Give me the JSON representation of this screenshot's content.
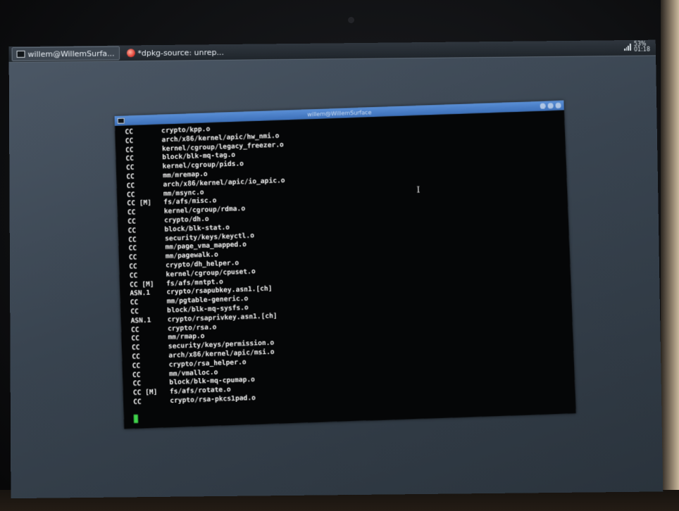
{
  "taskbar": {
    "tasks": [
      {
        "label": "willem@WillemSurfa...",
        "icon": "terminal-icon",
        "active": true
      },
      {
        "label": "*dpkg-source: unrep...",
        "icon": "package-warning-icon",
        "active": false
      }
    ],
    "tray": {
      "battery": "53%",
      "clock": "01:18"
    }
  },
  "terminal": {
    "title": "willem@WillemSurface",
    "lines": [
      {
        "tag": "CC",
        "path": "crypto/kpp.o"
      },
      {
        "tag": "CC",
        "path": "arch/x86/kernel/apic/hw_nmi.o"
      },
      {
        "tag": "CC",
        "path": "kernel/cgroup/legacy_freezer.o"
      },
      {
        "tag": "CC",
        "path": "block/blk-mq-tag.o"
      },
      {
        "tag": "CC",
        "path": "kernel/cgroup/pids.o"
      },
      {
        "tag": "CC",
        "path": "mm/mremap.o"
      },
      {
        "tag": "CC",
        "path": "arch/x86/kernel/apic/io_apic.o"
      },
      {
        "tag": "CC",
        "path": "mm/msync.o"
      },
      {
        "tag": "CC [M]",
        "path": "fs/afs/misc.o"
      },
      {
        "tag": "CC",
        "path": "kernel/cgroup/rdma.o"
      },
      {
        "tag": "CC",
        "path": "crypto/dh.o"
      },
      {
        "tag": "CC",
        "path": "block/blk-stat.o"
      },
      {
        "tag": "CC",
        "path": "security/keys/keyctl.o"
      },
      {
        "tag": "CC",
        "path": "mm/page_vma_mapped.o"
      },
      {
        "tag": "CC",
        "path": "mm/pagewalk.o"
      },
      {
        "tag": "CC",
        "path": "crypto/dh_helper.o"
      },
      {
        "tag": "CC",
        "path": "kernel/cgroup/cpuset.o"
      },
      {
        "tag": "CC [M]",
        "path": "fs/afs/mntpt.o"
      },
      {
        "tag": "ASN.1",
        "path": "crypto/rsapubkey.asn1.[ch]"
      },
      {
        "tag": "CC",
        "path": "mm/pgtable-generic.o"
      },
      {
        "tag": "CC",
        "path": "block/blk-mq-sysfs.o"
      },
      {
        "tag": "ASN.1",
        "path": "crypto/rsaprivkey.asn1.[ch]"
      },
      {
        "tag": "CC",
        "path": "crypto/rsa.o"
      },
      {
        "tag": "CC",
        "path": "mm/rmap.o"
      },
      {
        "tag": "CC",
        "path": "security/keys/permission.o"
      },
      {
        "tag": "CC",
        "path": "arch/x86/kernel/apic/msi.o"
      },
      {
        "tag": "CC",
        "path": "crypto/rsa_helper.o"
      },
      {
        "tag": "CC",
        "path": "mm/vmalloc.o"
      },
      {
        "tag": "CC",
        "path": "block/blk-mq-cpumap.o"
      },
      {
        "tag": "CC [M]",
        "path": "fs/afs/rotate.o"
      },
      {
        "tag": "CC",
        "path": "crypto/rsa-pkcs1pad.o"
      }
    ],
    "cursor_color": "#3fd14a"
  }
}
